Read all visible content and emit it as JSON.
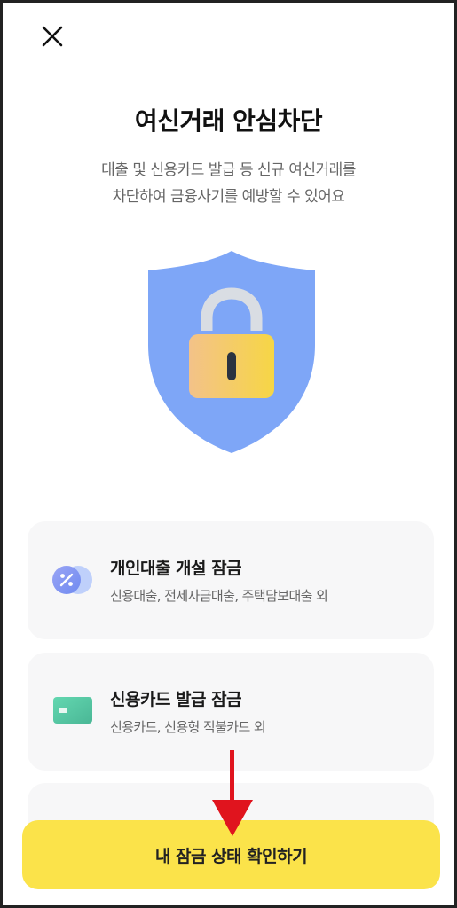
{
  "header": {
    "close_icon": "close-icon"
  },
  "hero": {
    "title": "여신거래 안심차단",
    "subtitle_line1": "대출 및 신용카드 발급 등 신규 여신거래를",
    "subtitle_line2": "차단하여 금융사기를 예방할 수 있어요",
    "illustration_icon": "shield-lock-icon",
    "colors": {
      "shield": "#7ea6f7",
      "lock_body": "#f6cf55",
      "lock_shackle": "#d9dde3"
    }
  },
  "items": [
    {
      "icon": "personal-loan-icon",
      "title": "개인대출 개설 잠금",
      "desc": "신용대출, 전세자금대출, 주택담보대출 외"
    },
    {
      "icon": "credit-card-icon",
      "title": "신용카드 발급 잠금",
      "desc": "신용카드, 신용형 직불카드 외"
    }
  ],
  "cta": {
    "label": "내 잠금 상태 확인하기",
    "color": "#fbe34a"
  },
  "annotation": {
    "arrow_icon": "red-down-arrow-icon",
    "color": "#e0141e"
  }
}
